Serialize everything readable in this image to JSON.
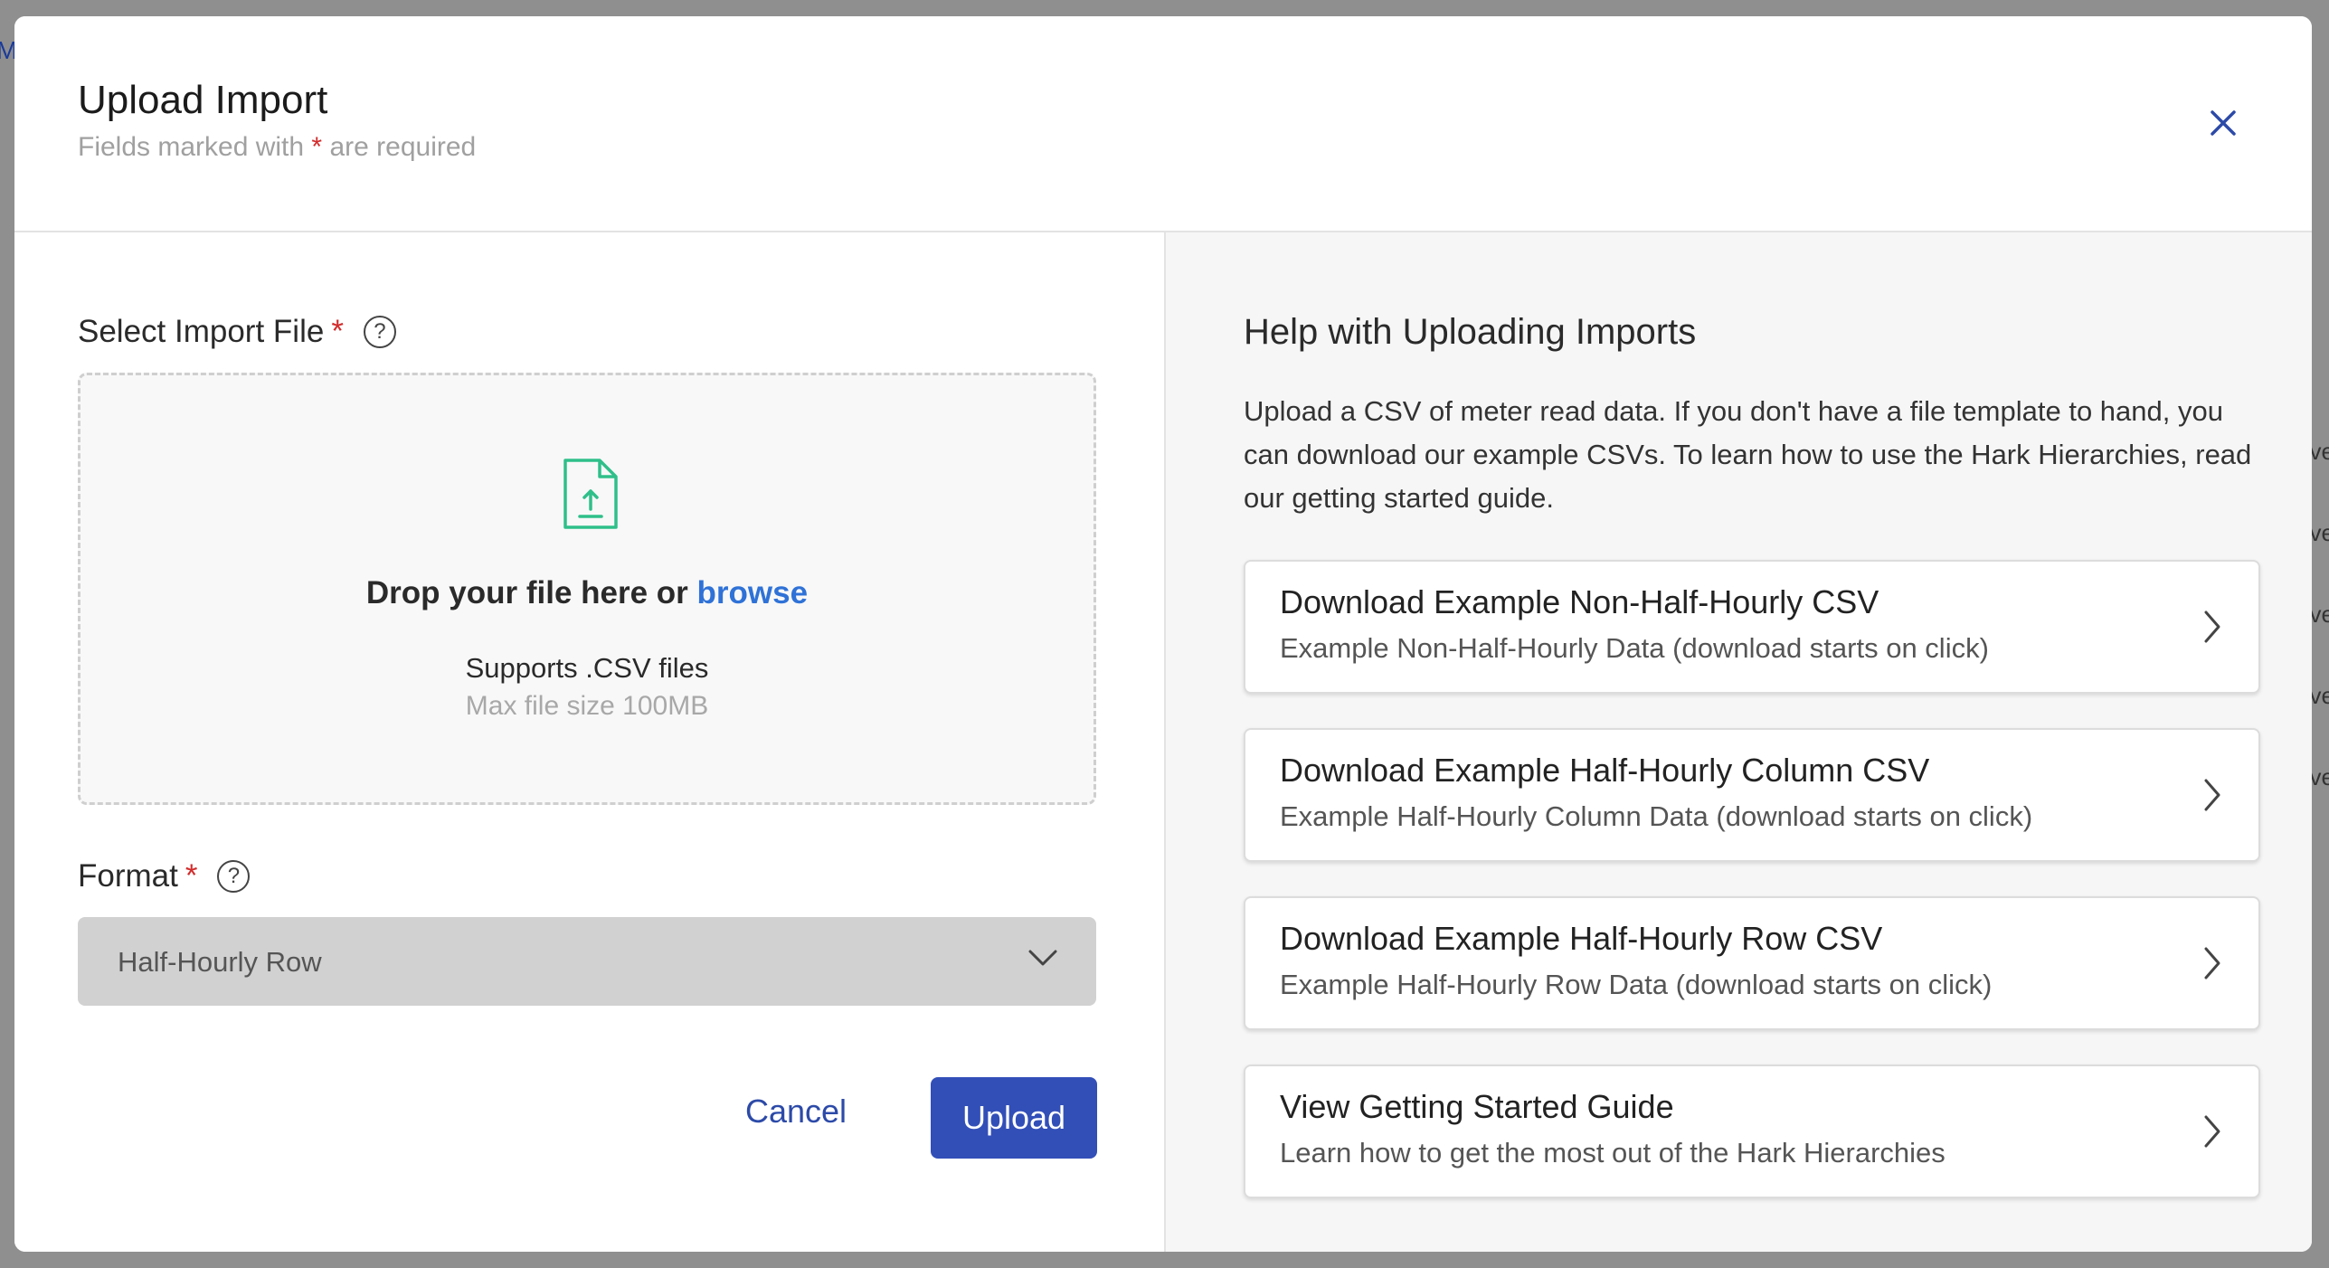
{
  "modal": {
    "title": "Upload Import",
    "subtitle_prefix": "Fields marked with",
    "required_marker": "*",
    "subtitle_suffix": "are required"
  },
  "form": {
    "file_label": "Select Import File",
    "dropzone": {
      "prompt": "Drop your file here or",
      "browse_label": "browse",
      "supports": "Supports .CSV files",
      "max_size": "Max file size 100MB"
    },
    "format_label": "Format",
    "format_value": "Half-Hourly Row",
    "cancel_label": "Cancel",
    "upload_label": "Upload"
  },
  "help": {
    "title": "Help with Uploading Imports",
    "body": "Upload a CSV of meter read data. If you don't have a file template to hand, you can download our example CSVs. To learn how to use the Hark Hierarchies, read our getting started guide.",
    "cards": [
      {
        "title": "Download Example Non-Half-Hourly CSV",
        "subtitle": "Example Non-Half-Hourly Data (download starts on click)"
      },
      {
        "title": "Download Example Half-Hourly Column CSV",
        "subtitle": "Example Half-Hourly Column Data (download starts on click)"
      },
      {
        "title": "Download Example Half-Hourly Row CSV",
        "subtitle": "Example Half-Hourly Row Data (download starts on click)"
      },
      {
        "title": "View Getting Started Guide",
        "subtitle": "Learn how to get the most out of the Hark Hierarchies"
      }
    ]
  },
  "backdrop": {
    "left_edge_text": "M",
    "right_edge_text": "ve"
  },
  "colors": {
    "primary": "#324fb8",
    "link": "#2f72d7",
    "required": "#d22c2c",
    "file_icon": "#2fbf8a",
    "close_icon": "#2c4aa8"
  },
  "icons": {
    "close": "close-icon",
    "help": "question-circle-icon",
    "file_upload": "file-upload-icon",
    "select": "chevron-down-icon",
    "card": "chevron-right-icon"
  }
}
